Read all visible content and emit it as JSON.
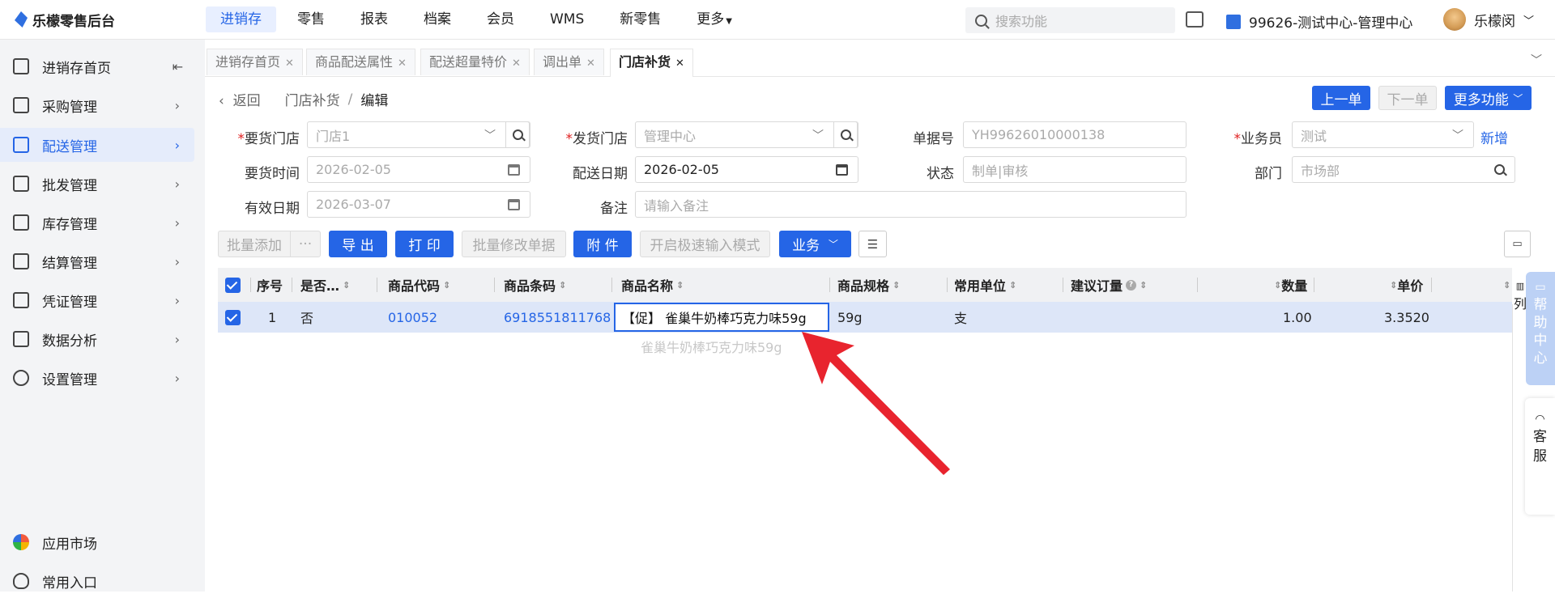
{
  "app": {
    "name": "乐檬零售后台"
  },
  "topnav": {
    "items": [
      "进销存",
      "零售",
      "报表",
      "档案",
      "会员",
      "WMS",
      "新零售",
      "更多"
    ],
    "search_placeholder": "搜索功能",
    "center": "99626-测试中心-管理中心",
    "user": "乐檬闵"
  },
  "sidebar": {
    "items": [
      "进销存首页",
      "采购管理",
      "配送管理",
      "批发管理",
      "库存管理",
      "结算管理",
      "凭证管理",
      "数据分析",
      "设置管理"
    ],
    "bottom": [
      "应用市场",
      "常用入口"
    ]
  },
  "tabs": [
    "进销存首页",
    "商品配送属性",
    "配送超量特价",
    "调出单",
    "门店补货"
  ],
  "breadcrumb": {
    "back": "返回",
    "parent": "门店补货",
    "current": "编辑"
  },
  "actions": {
    "prev": "上一单",
    "next": "下一单",
    "more": "更多功能"
  },
  "form": {
    "req_store_label": "要货门店",
    "req_store_placeholder": "门店1",
    "send_store_label": "发货门店",
    "send_store_placeholder": "管理中心",
    "doc_no_label": "单据号",
    "doc_no_placeholder": "YH99626010000138",
    "salesman_label": "业务员",
    "salesman_placeholder": "测试",
    "new_link": "新增",
    "req_time_label": "要货时间",
    "req_time_placeholder": "2026-02-05",
    "delivery_date_label": "配送日期",
    "delivery_date_value": "2026-02-05",
    "status_label": "状态",
    "status_placeholder": "制单|审核",
    "dept_label": "部门",
    "dept_placeholder": "市场部",
    "valid_date_label": "有效日期",
    "valid_date_placeholder": "2026-03-07",
    "remark_label": "备注",
    "remark_placeholder": "请输入备注"
  },
  "toolbar": {
    "batch_add": "批量添加",
    "ellipsis": "···",
    "export": "导 出",
    "print": "打 印",
    "batch_modify": "批量修改单据",
    "attach": "附 件",
    "fast_input": "开启极速输入模式",
    "business": "业务"
  },
  "table": {
    "columns": [
      "序号",
      "是否…",
      "商品代码",
      "商品条码",
      "商品名称",
      "商品规格",
      "常用单位",
      "建议订量",
      "数量",
      "单价"
    ],
    "column_extra": "列",
    "rows": [
      {
        "seq": "1",
        "flag": "否",
        "code": "010052",
        "barcode": "6918551811768",
        "name": "【促】 雀巢牛奶棒巧克力味59g",
        "spec": "59g",
        "unit": "支",
        "suggest": "",
        "qty": "1.00",
        "price": "3.3520"
      }
    ],
    "suggestion": "雀巢牛奶棒巧克力味59g"
  },
  "side_widgets": {
    "help": [
      "帮",
      "助",
      "中",
      "心"
    ],
    "service": [
      "客",
      "服"
    ]
  },
  "colors": {
    "accent": "#2565e6",
    "annotation_arrow": "#e8242e",
    "row_selected": "#dde6f8"
  }
}
